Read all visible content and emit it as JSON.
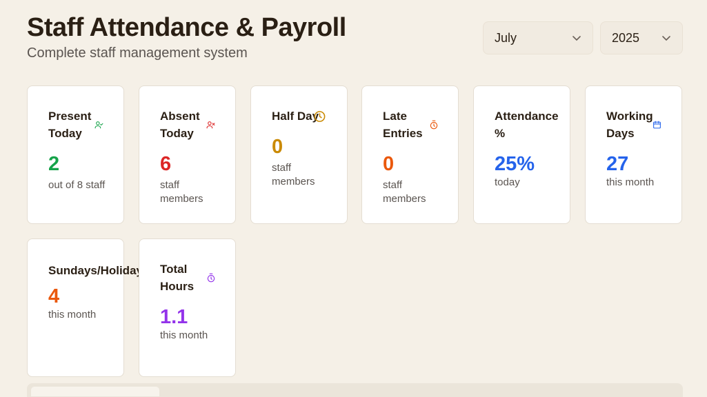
{
  "header": {
    "title": "Staff Attendance & Payroll",
    "subtitle": "Complete staff management system"
  },
  "filters": {
    "month": "July",
    "year": "2025"
  },
  "cards": [
    {
      "title": "Present Today",
      "value": "2",
      "sub": "out of 8 staff",
      "icon": "user-check-icon",
      "color": "#16a34a"
    },
    {
      "title": "Absent Today",
      "value": "6",
      "sub": "staff members",
      "icon": "user-x-icon",
      "color": "#dc2626"
    },
    {
      "title": "Half Day",
      "value": "0",
      "sub": "staff members",
      "icon": "clock-icon",
      "color": "#ca8a04"
    },
    {
      "title": "Late Entries",
      "value": "0",
      "sub": "staff members",
      "icon": "timer-icon",
      "color": "#ea580c"
    },
    {
      "title": "Attendance %",
      "value": "25%",
      "sub": "today",
      "icon": "",
      "color": "#2563eb"
    },
    {
      "title": "Working Days",
      "value": "27",
      "sub": "this month",
      "icon": "calendar-icon",
      "color": "#2563eb"
    },
    {
      "title": "Sundays/Holidays",
      "value": "4",
      "sub": "this month",
      "icon": "",
      "color": "#ea580c"
    },
    {
      "title": "Total Hours",
      "value": "1.1",
      "sub": "this month",
      "icon": "timer-icon",
      "color": "#9333ea"
    }
  ]
}
